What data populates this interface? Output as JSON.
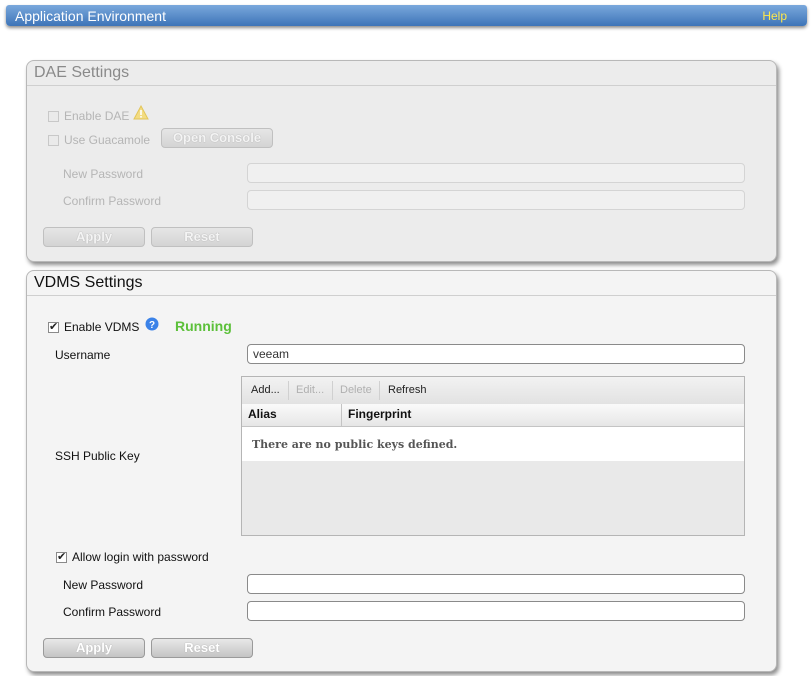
{
  "header": {
    "title": "Application Environment",
    "help": "Help"
  },
  "dae": {
    "title": "DAE Settings",
    "enable_label": "Enable DAE",
    "guacamole_label": "Use Guacamole",
    "open_console": "Open Console",
    "new_password_label": "New Password",
    "confirm_password_label": "Confirm Password",
    "new_password_value": "",
    "confirm_password_value": "",
    "apply": "Apply",
    "reset": "Reset"
  },
  "vdms": {
    "title": "VDMS Settings",
    "enable_label": "Enable VDMS",
    "enabled": true,
    "status": "Running",
    "status_color": "#5cc03a",
    "username_label": "Username",
    "username_value": "veeam",
    "ssh_label": "SSH Public Key",
    "toolbar": {
      "add": "Add...",
      "edit": "Edit...",
      "delete": "Delete",
      "refresh": "Refresh"
    },
    "columns": [
      "Alias",
      "Fingerprint"
    ],
    "empty_text": "There are no public keys defined.",
    "allow_password_label": "Allow login with password",
    "allow_password": true,
    "new_password_label": "New Password",
    "confirm_password_label": "Confirm Password",
    "new_password_value": "",
    "confirm_password_value": "",
    "apply": "Apply",
    "reset": "Reset"
  },
  "colors": {
    "title_bar": "#4a80c4",
    "help_text": "#ffe84a",
    "warning_icon": "#f0d878",
    "help_icon": "#3b82e8"
  }
}
